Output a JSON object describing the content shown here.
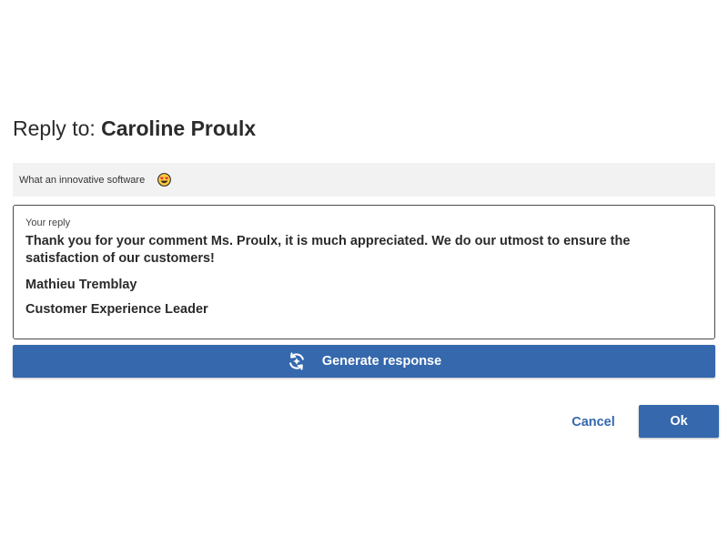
{
  "dialog": {
    "title_prefix": "Reply to:",
    "title_name": "Caroline Proulx"
  },
  "comment": {
    "text": "What an innovative software",
    "emoji_icon": "heart-eyes-emoji-icon"
  },
  "reply": {
    "label": "Your reply",
    "paragraph_1": "Thank you for your comment Ms. Proulx, it is much appreciated. We do our utmost to ensure the satisfaction of our customers!",
    "signature_name": "Mathieu Tremblay",
    "signature_title": "Customer Experience Leader"
  },
  "generate_button": {
    "label": "Generate response",
    "icon": "ai-generate-icon"
  },
  "actions": {
    "cancel_label": "Cancel",
    "ok_label": "Ok"
  },
  "colors": {
    "primary": "#3568ad",
    "comment_background": "#f2f2f2",
    "text": "#2b2b2b"
  }
}
